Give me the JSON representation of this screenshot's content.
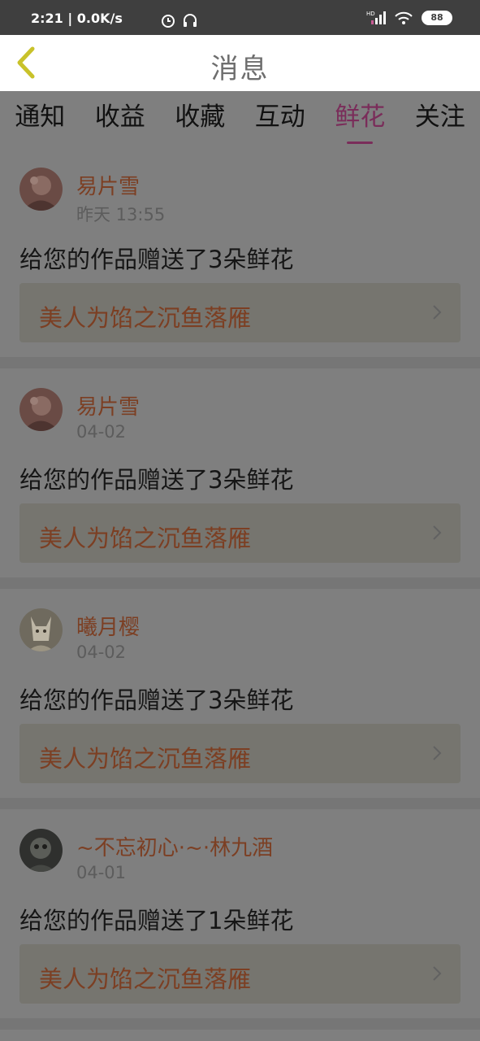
{
  "status_bar": {
    "time": "2:21 | 0.0K/s",
    "icons": [
      "alarm-icon",
      "headphones-icon",
      "hd-signal-icon",
      "wifi-icon",
      "battery-icon"
    ],
    "battery": "88"
  },
  "header": {
    "title": "消息",
    "back_icon": "chevron-left-icon"
  },
  "tabs": [
    {
      "label": "通知",
      "active": false
    },
    {
      "label": "收益",
      "active": false
    },
    {
      "label": "收藏",
      "active": false
    },
    {
      "label": "互动",
      "active": false
    },
    {
      "label": "鲜花",
      "active": true
    },
    {
      "label": "关注",
      "active": false
    }
  ],
  "messages": [
    {
      "user": "易片雪",
      "time": "昨天 13:55",
      "text": "给您的作品赠送了3朵鲜花",
      "work": "美人为馅之沉鱼落雁"
    },
    {
      "user": "易片雪",
      "time": "04-02",
      "text": "给您的作品赠送了3朵鲜花",
      "work": "美人为馅之沉鱼落雁"
    },
    {
      "user": "曦月樱",
      "time": "04-02",
      "text": "给您的作品赠送了3朵鲜花",
      "work": "美人为馅之沉鱼落雁"
    },
    {
      "user": "~不忘初心·~·林九酒",
      "time": "04-01",
      "text": "给您的作品赠送了1朵鲜花",
      "work": "美人为馅之沉鱼落雁"
    }
  ],
  "colors": {
    "accent": "#7a2d5a",
    "name_color": "#7c3f23",
    "header_bg": "#ffffff",
    "overlay_bg": "#7f7f7f",
    "status_bar_bg": "#3f3f3f",
    "back_icon": "#c9c22a"
  }
}
